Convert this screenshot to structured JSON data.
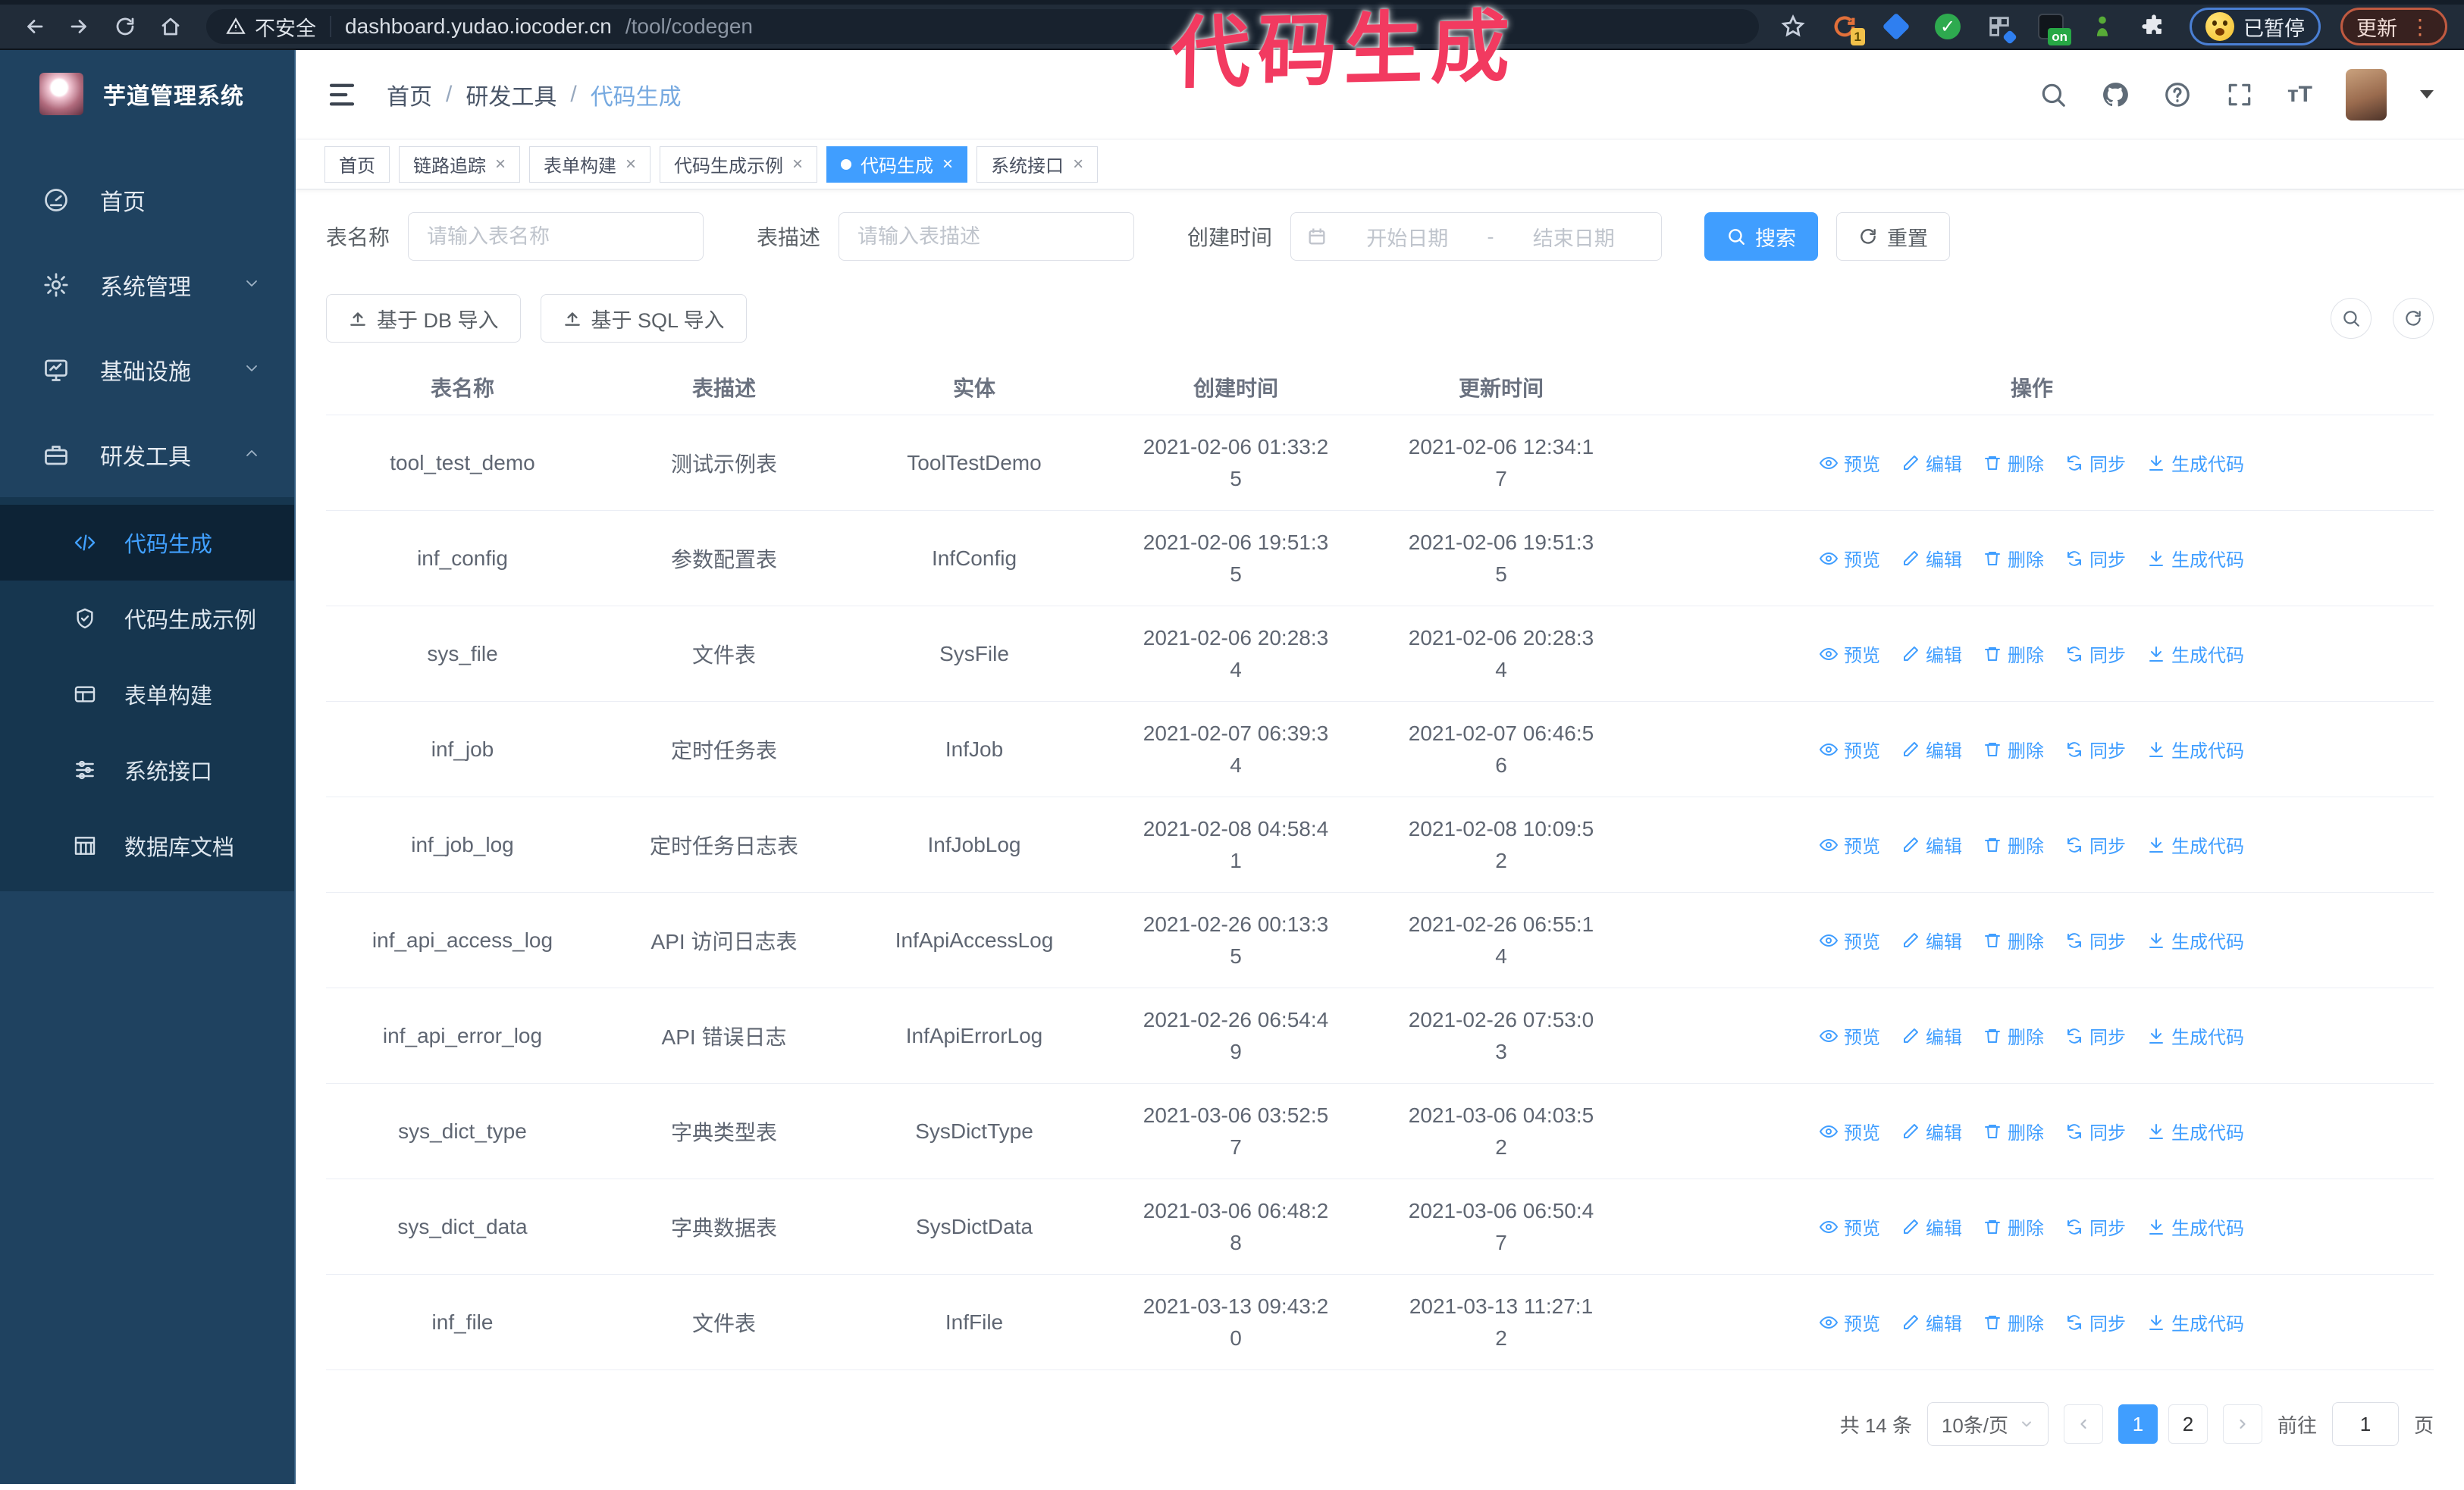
{
  "browser": {
    "security_label": "不安全",
    "url_host": "dashboard.yudao.iocoder.cn",
    "url_path": "/tool/codegen",
    "ext_badge_one": "1",
    "ext_badge_on": "on",
    "paused_label": "已暂停",
    "update_label": "更新"
  },
  "annotation": "代码生成",
  "sidebar": {
    "title": "芋道管理系统",
    "items": [
      {
        "label": "首页"
      },
      {
        "label": "系统管理"
      },
      {
        "label": "基础设施"
      },
      {
        "label": "研发工具"
      }
    ],
    "submenu": [
      {
        "label": "代码生成"
      },
      {
        "label": "代码生成示例"
      },
      {
        "label": "表单构建"
      },
      {
        "label": "系统接口"
      },
      {
        "label": "数据库文档"
      }
    ]
  },
  "header": {
    "breadcrumb": [
      "首页",
      "研发工具",
      "代码生成"
    ]
  },
  "tabs": [
    {
      "label": "首页",
      "closable": false,
      "active": false
    },
    {
      "label": "链路追踪",
      "closable": true,
      "active": false
    },
    {
      "label": "表单构建",
      "closable": true,
      "active": false
    },
    {
      "label": "代码生成示例",
      "closable": true,
      "active": false
    },
    {
      "label": "代码生成",
      "closable": true,
      "active": true
    },
    {
      "label": "系统接口",
      "closable": true,
      "active": false
    }
  ],
  "filters": {
    "table_name_label": "表名称",
    "table_name_placeholder": "请输入表名称",
    "table_desc_label": "表描述",
    "table_desc_placeholder": "请输入表描述",
    "create_time_label": "创建时间",
    "start_placeholder": "开始日期",
    "range_separator": "-",
    "end_placeholder": "结束日期",
    "search_label": "搜索",
    "reset_label": "重置"
  },
  "toolbar": {
    "import_db": "基于 DB 导入",
    "import_sql": "基于 SQL 导入"
  },
  "table": {
    "columns": [
      "表名称",
      "表描述",
      "实体",
      "创建时间",
      "更新时间",
      "操作"
    ],
    "actions": [
      "预览",
      "编辑",
      "删除",
      "同步",
      "生成代码"
    ],
    "rows": [
      {
        "name": "tool_test_demo",
        "desc": "测试示例表",
        "entity": "ToolTestDemo",
        "created": "2021-02-06 01:33:25",
        "updated": "2021-02-06 12:34:17"
      },
      {
        "name": "inf_config",
        "desc": "参数配置表",
        "entity": "InfConfig",
        "created": "2021-02-06 19:51:35",
        "updated": "2021-02-06 19:51:35"
      },
      {
        "name": "sys_file",
        "desc": "文件表",
        "entity": "SysFile",
        "created": "2021-02-06 20:28:34",
        "updated": "2021-02-06 20:28:34"
      },
      {
        "name": "inf_job",
        "desc": "定时任务表",
        "entity": "InfJob",
        "created": "2021-02-07 06:39:34",
        "updated": "2021-02-07 06:46:56"
      },
      {
        "name": "inf_job_log",
        "desc": "定时任务日志表",
        "entity": "InfJobLog",
        "created": "2021-02-08 04:58:41",
        "updated": "2021-02-08 10:09:52"
      },
      {
        "name": "inf_api_access_log",
        "desc": "API 访问日志表",
        "entity": "InfApiAccessLog",
        "created": "2021-02-26 00:13:35",
        "updated": "2021-02-26 06:55:14"
      },
      {
        "name": "inf_api_error_log",
        "desc": "API 错误日志",
        "entity": "InfApiErrorLog",
        "created": "2021-02-26 06:54:49",
        "updated": "2021-02-26 07:53:03"
      },
      {
        "name": "sys_dict_type",
        "desc": "字典类型表",
        "entity": "SysDictType",
        "created": "2021-03-06 03:52:57",
        "updated": "2021-03-06 04:03:52"
      },
      {
        "name": "sys_dict_data",
        "desc": "字典数据表",
        "entity": "SysDictData",
        "created": "2021-03-06 06:48:28",
        "updated": "2021-03-06 06:50:47"
      },
      {
        "name": "inf_file",
        "desc": "文件表",
        "entity": "InfFile",
        "created": "2021-03-13 09:43:20",
        "updated": "2021-03-13 11:27:12"
      }
    ]
  },
  "pagination": {
    "total": "共 14 条",
    "page_size": "10条/页",
    "pages": [
      "1",
      "2"
    ],
    "current": "1",
    "goto_label": "前往",
    "goto_value": "1",
    "goto_unit": "页"
  },
  "colors": {
    "accent": "#409eff",
    "annotation_pink": "#f23a60",
    "sidebar_bg": "#1f4260"
  }
}
